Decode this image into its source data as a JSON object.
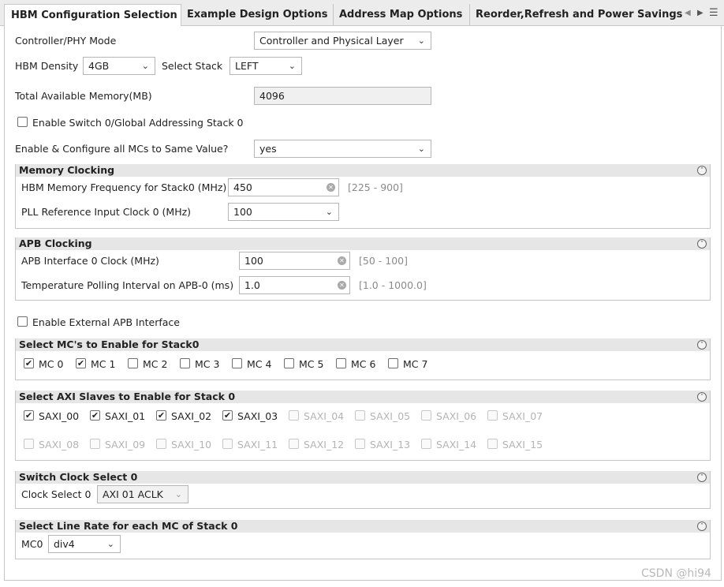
{
  "tabs": [
    {
      "label": "HBM Configuration Selection",
      "active": true
    },
    {
      "label": "Example Design Options"
    },
    {
      "label": "Address Map Options"
    },
    {
      "label": "Reorder,Refresh and Power Savings"
    }
  ],
  "top": {
    "controller_phy_mode": {
      "label": "Controller/PHY Mode",
      "value": "Controller and Physical Layer"
    },
    "hbm_density": {
      "label": "HBM Density",
      "value": "4GB"
    },
    "select_stack": {
      "label": "Select Stack",
      "value": "LEFT"
    },
    "total_memory": {
      "label": "Total Available Memory(MB)",
      "value": "4096"
    },
    "enable_switch": {
      "label": "Enable Switch 0/Global Addressing Stack 0",
      "checked": false
    },
    "same_value": {
      "label": "Enable & Configure all MCs to Same Value?",
      "value": "yes"
    },
    "external_apb": {
      "label": "Enable External APB Interface",
      "checked": false
    }
  },
  "memory_clocking": {
    "title": "Memory Clocking",
    "freq": {
      "label": "HBM Memory Frequency for Stack0 (MHz)",
      "value": "450",
      "range": "[225 - 900]"
    },
    "pll": {
      "label": "PLL Reference Input Clock 0 (MHz)",
      "value": "100"
    }
  },
  "apb_clocking": {
    "title": "APB Clocking",
    "apb_clock": {
      "label": "APB Interface 0 Clock (MHz)",
      "value": "100",
      "range": "[50 - 100]"
    },
    "temp_poll": {
      "label": "Temperature Polling Interval on APB-0 (ms)",
      "value": "1.0",
      "range": "[1.0 - 1000.0]"
    }
  },
  "mcs": {
    "title": "Select MC's to Enable for Stack0",
    "items": [
      {
        "label": "MC 0",
        "checked": true
      },
      {
        "label": "MC 1",
        "checked": true
      },
      {
        "label": "MC 2",
        "checked": false
      },
      {
        "label": "MC 3",
        "checked": false
      },
      {
        "label": "MC 4",
        "checked": false
      },
      {
        "label": "MC 5",
        "checked": false
      },
      {
        "label": "MC 6",
        "checked": false
      },
      {
        "label": "MC 7",
        "checked": false
      }
    ]
  },
  "axi": {
    "title": "Select AXI Slaves to Enable for Stack 0",
    "items": [
      {
        "label": "SAXI_00",
        "checked": true,
        "enabled": true
      },
      {
        "label": "SAXI_01",
        "checked": true,
        "enabled": true
      },
      {
        "label": "SAXI_02",
        "checked": true,
        "enabled": true
      },
      {
        "label": "SAXI_03",
        "checked": true,
        "enabled": true
      },
      {
        "label": "SAXI_04",
        "checked": false,
        "enabled": false
      },
      {
        "label": "SAXI_05",
        "checked": false,
        "enabled": false
      },
      {
        "label": "SAXI_06",
        "checked": false,
        "enabled": false
      },
      {
        "label": "SAXI_07",
        "checked": false,
        "enabled": false
      },
      {
        "label": "SAXI_08",
        "checked": false,
        "enabled": false
      },
      {
        "label": "SAXI_09",
        "checked": false,
        "enabled": false
      },
      {
        "label": "SAXI_10",
        "checked": false,
        "enabled": false
      },
      {
        "label": "SAXI_11",
        "checked": false,
        "enabled": false
      },
      {
        "label": "SAXI_12",
        "checked": false,
        "enabled": false
      },
      {
        "label": "SAXI_13",
        "checked": false,
        "enabled": false
      },
      {
        "label": "SAXI_14",
        "checked": false,
        "enabled": false
      },
      {
        "label": "SAXI_15",
        "checked": false,
        "enabled": false
      }
    ]
  },
  "switch_clock": {
    "title": "Switch Clock Select 0",
    "label": "Clock Select 0",
    "value": "AXI 01 ACLK"
  },
  "line_rate": {
    "title": "Select Line Rate for each MC of Stack 0",
    "label": "MC0",
    "value": "div4"
  },
  "watermark": "CSDN @hi94",
  "icons": {
    "chevron": "chevron-down-icon",
    "clear": "clear-icon",
    "collapse": "collapse-icon",
    "check": "check-icon"
  }
}
